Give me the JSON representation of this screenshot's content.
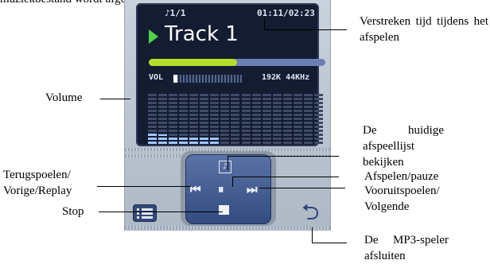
{
  "intro_text": "muziekbestand wordt afgespeeld.",
  "player": {
    "playlist_position": "♪1/1",
    "time": "01:11/02:23",
    "track_title": "Track 1",
    "progress_fraction": 0.5,
    "volume_label": "VOL",
    "volume_fraction": 0.06,
    "bitrate": "192K 44KHz",
    "eq_levels": [
      0.24,
      0.18,
      0.12,
      0.12,
      0.12,
      0.12,
      0.12,
      0.0,
      0.0,
      0.0,
      0.0,
      0.0,
      0.0,
      0.0,
      0.0,
      0.0,
      0.0
    ],
    "controls": {
      "playlist_icon": "music-note-icon",
      "rewind_symbol": "⏮",
      "play_pause_symbol": "⏸",
      "forward_symbol": "⏭",
      "back_symbol": "⮌"
    },
    "colors": {
      "screen": "#131c31",
      "play_green": "#4fd24a",
      "progress": "#b6dc2a",
      "pad": "#3c5589"
    }
  },
  "callouts": {
    "elapsed_time": "Verstreken tijd tijdens het afspelen",
    "volume": "Volume",
    "view_playlist": "De huidige afspeellijst bekijken",
    "play_pause": "Afspelen/pauze",
    "rewind": "Terugspoelen/ Vorige/Replay",
    "forward": "Vooruitspoelen/ Volgende",
    "stop": "Stop",
    "exit": "De MP3-speler afsluiten"
  }
}
